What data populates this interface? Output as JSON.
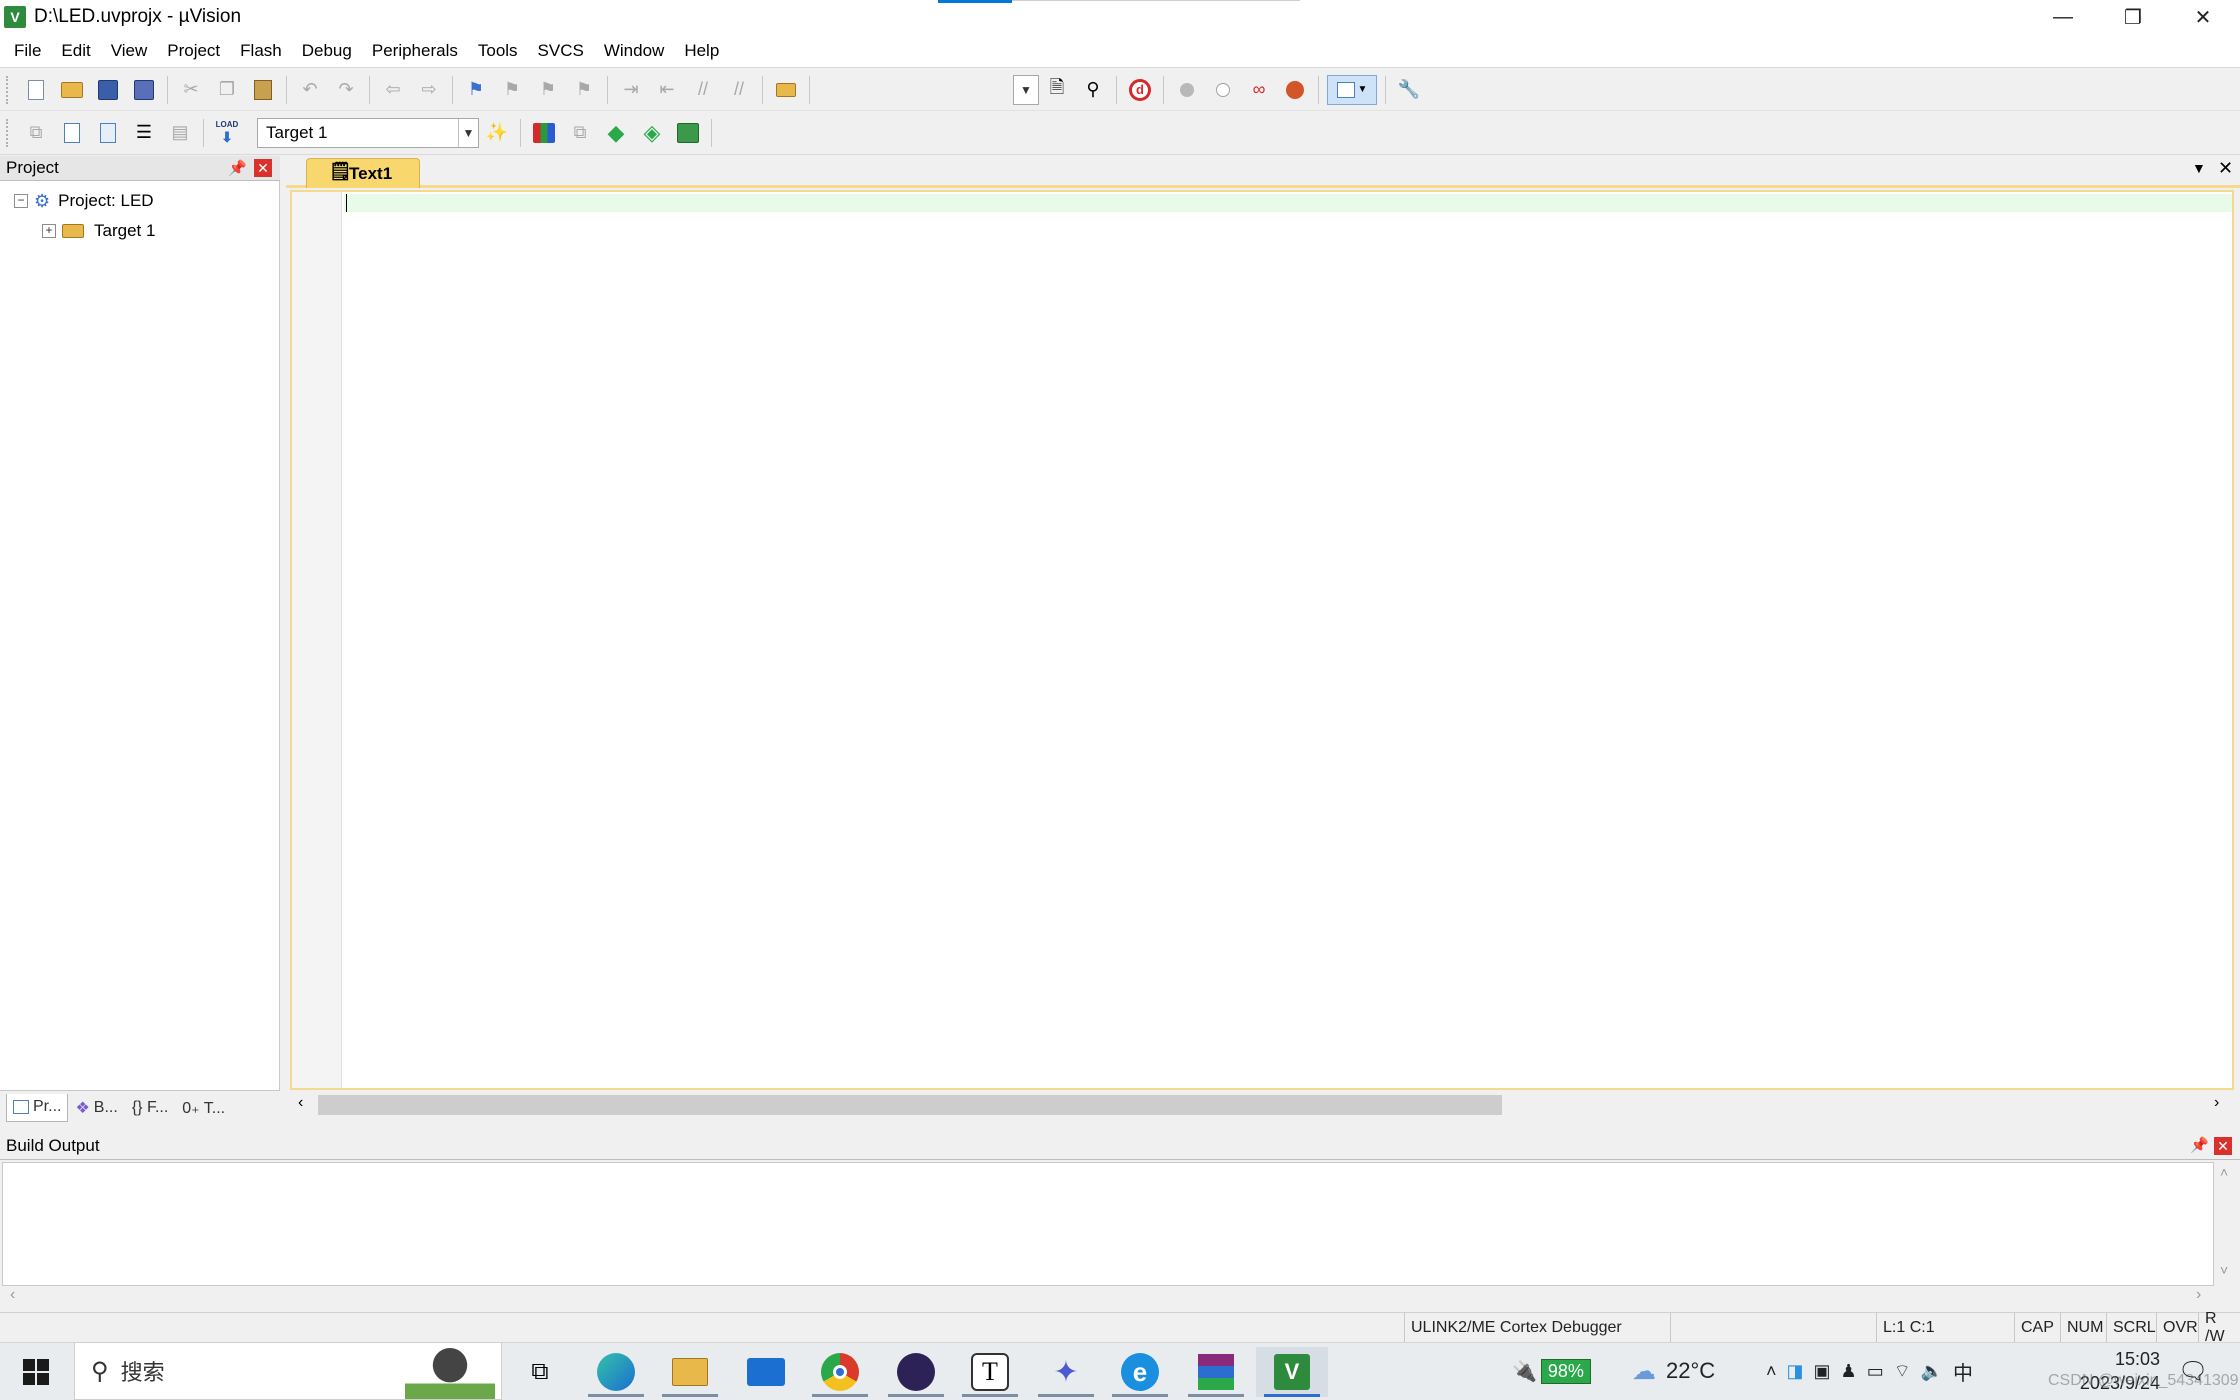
{
  "window": {
    "title": "D:\\LED.uvprojx - µVision",
    "app_icon_glyph": "V",
    "controls": {
      "minimize": "—",
      "restore": "❐",
      "close": "✕"
    }
  },
  "menu": [
    "File",
    "Edit",
    "View",
    "Project",
    "Flash",
    "Debug",
    "Peripherals",
    "Tools",
    "SVCS",
    "Window",
    "Help"
  ],
  "toolbar2": {
    "target_select_value": "Target 1",
    "load_label": "LOAD"
  },
  "project_panel": {
    "header": "Project",
    "tree": [
      {
        "label": "Project: LED",
        "expander": "−"
      },
      {
        "label": "Target 1",
        "expander": "+"
      }
    ],
    "tabs": [
      "Pr...",
      "B...",
      "{} F...",
      "0₊ T..."
    ]
  },
  "editor": {
    "tab_label": "Text1"
  },
  "build_output": {
    "header": "Build Output"
  },
  "status": {
    "debugger": "ULINK2/ME Cortex Debugger",
    "position": "L:1 C:1",
    "cap": "CAP",
    "num": "NUM",
    "scrl": "SCRL",
    "ovr": "OVR",
    "rw": "R /W"
  },
  "taskbar": {
    "search_placeholder": "搜索",
    "battery": "98%",
    "weather_temp": "22°C",
    "ime": "中",
    "time": "15:03",
    "date": "2023/9/24",
    "watermark": "CSDN @weixin_54341309"
  },
  "colors": {
    "accent": "#0078d7",
    "active_tab": "#f8d86e",
    "current_line": "#e8fbe8",
    "close_red": "#d9312b"
  }
}
